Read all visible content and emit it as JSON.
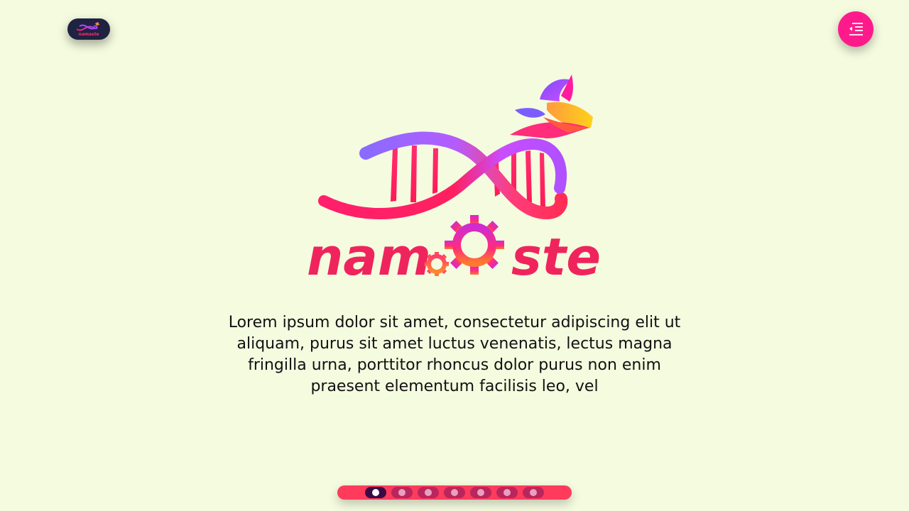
{
  "header": {
    "brand_name": "namaste",
    "logo_icon": "namaste-dna-logo",
    "menu_icon": "menu-indent-icon"
  },
  "hero": {
    "logo_text_left": "nam",
    "logo_text_right": "ste",
    "description": "Lorem ipsum dolor sit amet, consectetur adipiscing elit ut aliquam, purus sit amet luctus venenatis, lectus magna fringilla urna, porttitor rhoncus dolor purus non enim praesent elementum facilisis leo, vel"
  },
  "pager": {
    "total": 7,
    "active_index": 0
  },
  "colors": {
    "background": "#f4fbdf",
    "accent_pink": "#ff1a8c",
    "logo_red": "#f0245c",
    "pager_bar": "#ff3b5c",
    "pager_active": "#3a0a47",
    "mini_logo_bg": "#1f2240"
  }
}
